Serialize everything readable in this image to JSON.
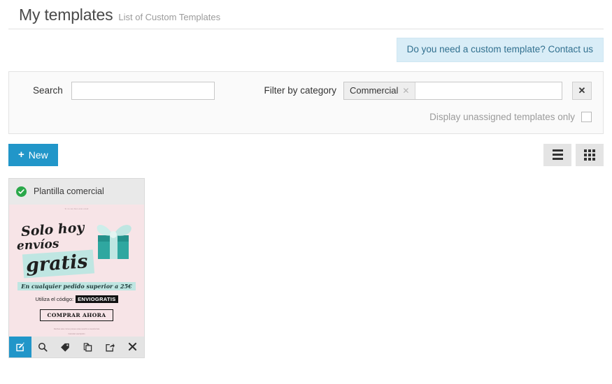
{
  "header": {
    "title": "My templates",
    "subtitle": "List of Custom Templates"
  },
  "banner": {
    "text": "Do you need a custom template? Contact us",
    "background": "#d9edf7",
    "text_color": "#31708f"
  },
  "filters": {
    "search_label": "Search",
    "search_value": "",
    "search_placeholder": "",
    "category_label": "Filter by category",
    "selected_categories": [
      "Commercial"
    ],
    "category_chip_remove_icon": "close-icon",
    "category_input_value": "",
    "clear_button_icon": "close-icon",
    "unassigned_label": "Display unassigned templates only",
    "unassigned_checked": false
  },
  "toolbar": {
    "new_label": "New",
    "new_icon": "plus-icon",
    "new_color": "#2196c9",
    "list_view_icon": "list-view-icon",
    "grid_view_icon": "grid-view-icon"
  },
  "cards": [
    {
      "title": "Plantilla comercial",
      "status_icon": "check-circle-icon",
      "status_color": "#2aa84a",
      "preview": {
        "background": "#f7e4e7",
        "micro_top": "Si no ves bien este email",
        "headline_1": "Solo hoy",
        "headline_2": "envíos",
        "headline_3": "gratis",
        "gift_icon": "gift-box-icon",
        "subline": "En cualquier pedido superior a 25€",
        "code_label": "Utiliza el código:",
        "code_value": "ENVIOGRATIS",
        "cta_label": "COMPRAR AHORA",
        "micro_bottom_1": "Recibes este correo porque estas suscrito a nuestra lista",
        "micro_bottom_2": "Cancelar suscripción"
      },
      "actions": [
        {
          "name": "edit",
          "icon": "edit-icon",
          "primary": true
        },
        {
          "name": "preview",
          "icon": "search-icon",
          "primary": false
        },
        {
          "name": "tag",
          "icon": "tag-icon",
          "primary": false
        },
        {
          "name": "duplicate",
          "icon": "copy-icon",
          "primary": false
        },
        {
          "name": "export",
          "icon": "share-icon",
          "primary": false
        },
        {
          "name": "delete",
          "icon": "close-icon",
          "primary": false
        }
      ]
    }
  ]
}
